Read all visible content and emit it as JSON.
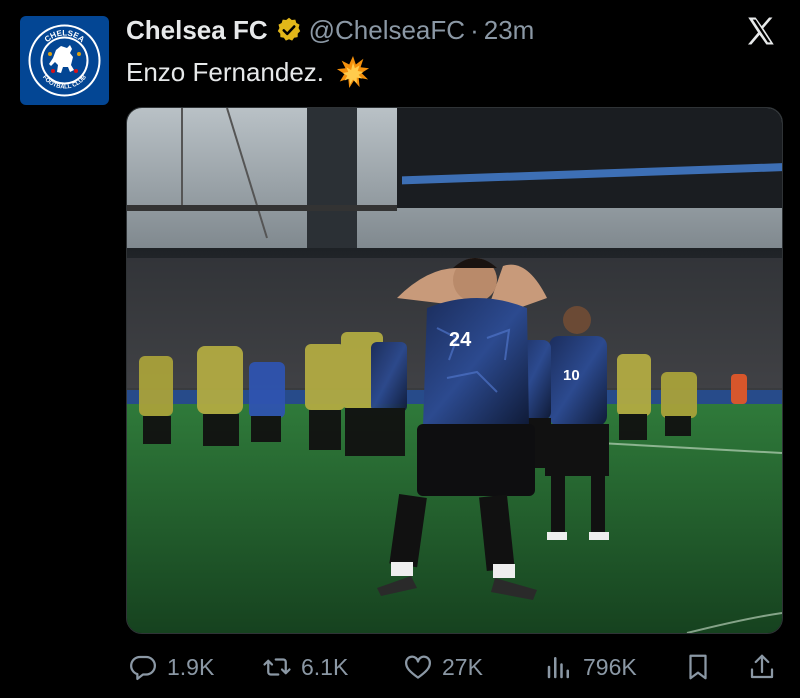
{
  "tweet": {
    "author_name": "Chelsea FC",
    "handle": "@ChelseaFC",
    "separator": "·",
    "time": "23m",
    "text": "Enzo Fernandez.",
    "emoji": "💥",
    "verified": true
  },
  "avatar": {
    "crest_top_text": "CHELSEA",
    "crest_bottom_text": "FOOTBALL CLUB",
    "color": "#034694"
  },
  "colors": {
    "background": "#000000",
    "text_primary": "#e7e9ea",
    "text_secondary": "#8b98a5",
    "verified_gold": "#e2b719"
  },
  "media": {
    "jersey_number_main": "24",
    "jersey_number_secondary": "10"
  },
  "stats": {
    "replies": "1.9K",
    "retweets": "6.1K",
    "likes": "27K",
    "views": "796K"
  },
  "icons": {
    "reply": "reply-icon",
    "retweet": "retweet-icon",
    "like": "heart-icon",
    "views": "views-chart-icon",
    "bookmark": "bookmark-icon",
    "share": "share-icon",
    "platform": "x-logo-icon",
    "verified": "verified-badge-icon"
  }
}
